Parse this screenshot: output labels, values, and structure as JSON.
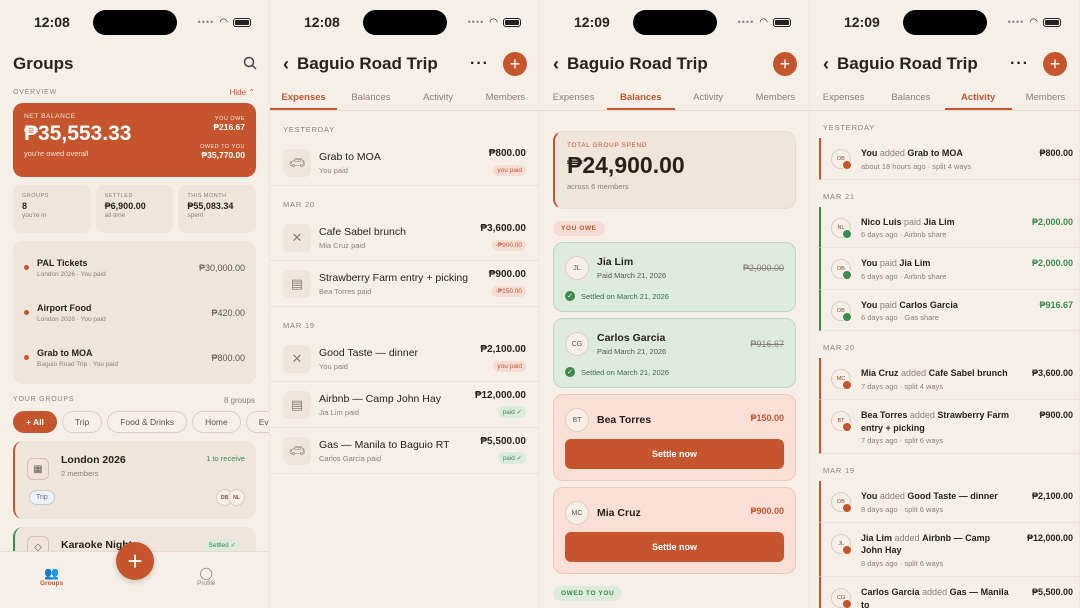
{
  "screen1": {
    "time": "12:08",
    "title": "Groups",
    "overview_label": "OVERVIEW",
    "hide_label": "Hide",
    "net_label": "NET BALANCE",
    "net_value": "₱35,553.33",
    "net_sub": "you're owed overall",
    "you_owe_label": "YOU OWE",
    "you_owe_value": "₱216.67",
    "owed_label": "OWED TO YOU",
    "owed_value": "₱35,770.00",
    "stats": [
      {
        "label": "GROUPS",
        "value": "8",
        "sub": "you're in"
      },
      {
        "label": "SETTLED",
        "value": "₱6,900.00",
        "sub": "all time"
      },
      {
        "label": "THIS MONTH",
        "value": "₱55,083.34",
        "sub": "spent"
      }
    ],
    "recent": [
      {
        "title": "PAL Tickets",
        "sub": "London 2026 · You paid",
        "amount": "₱30,000.00"
      },
      {
        "title": "Airport Food",
        "sub": "London 2026 · You paid",
        "amount": "₱420.00"
      },
      {
        "title": "Grab to MOA",
        "sub": "Baguio Road Trip · You paid",
        "amount": "₱800.00"
      }
    ],
    "your_groups_label": "YOUR GROUPS",
    "groups_count": "8 groups",
    "chips": [
      "+ All",
      "Trip",
      "Food & Drinks",
      "Home",
      "Eve"
    ],
    "group1": {
      "name": "London 2026",
      "members": "2 members",
      "status": "1 to receive",
      "tag": "Trip",
      "avatars": [
        "DB",
        "NL"
      ]
    },
    "group2": {
      "name": "Karaoke Night",
      "status": "Settled ✓"
    },
    "nav": {
      "groups": "Groups",
      "profile": "Profile"
    }
  },
  "screen2": {
    "time": "12:08",
    "title": "Baguio Road Trip",
    "tabs": [
      "Expenses",
      "Balances",
      "Activity",
      "Members"
    ],
    "sections": [
      {
        "label": "YESTERDAY",
        "items": [
          {
            "title": "Grab to MOA",
            "sub": "You paid",
            "amount": "₱800.00",
            "pill": "you paid",
            "pill_type": "red",
            "icon": "car"
          }
        ]
      },
      {
        "label": "MAR 20",
        "items": [
          {
            "title": "Cafe Sabel brunch",
            "sub": "Mia Cruz paid",
            "amount": "₱3,600.00",
            "pill": "-₱900.00",
            "pill_type": "red",
            "icon": "food"
          },
          {
            "title": "Strawberry Farm entry + picking",
            "sub": "Bea Torres paid",
            "amount": "₱900.00",
            "pill": "-₱150.00",
            "pill_type": "red",
            "icon": "receipt"
          }
        ]
      },
      {
        "label": "MAR 19",
        "items": [
          {
            "title": "Good Taste — dinner",
            "sub": "You paid",
            "amount": "₱2,100.00",
            "pill": "you paid",
            "pill_type": "red",
            "icon": "food"
          },
          {
            "title": "Airbnb — Camp John Hay",
            "sub": "Jia Lim paid",
            "amount": "₱12,000.00",
            "pill": "paid ✓",
            "pill_type": "green",
            "icon": "receipt"
          },
          {
            "title": "Gas — Manila to Baguio RT",
            "sub": "Carlos Garcia paid",
            "amount": "₱5,500.00",
            "pill": "paid ✓",
            "pill_type": "green",
            "icon": "car"
          }
        ]
      }
    ]
  },
  "screen3": {
    "time": "12:09",
    "title": "Baguio Road Trip",
    "tabs": [
      "Expenses",
      "Balances",
      "Activity",
      "Members"
    ],
    "total_label": "TOTAL GROUP SPEND",
    "total_value": "₱24,900.00",
    "total_sub": "across 6 members",
    "you_owe_label": "YOU OWE",
    "owed_to_you_label": "OWED TO YOU",
    "settled_cards": [
      {
        "initials": "JL",
        "name": "Jia Lim",
        "paid": "Paid March 21, 2026",
        "amount": "₱2,000.00",
        "settled": "Settled on March 21, 2026"
      },
      {
        "initials": "CG",
        "name": "Carlos Garcia",
        "paid": "Paid March 21, 2026",
        "amount": "₱916.67",
        "settled": "Settled on March 21, 2026"
      }
    ],
    "owe_cards": [
      {
        "initials": "BT",
        "name": "Bea Torres",
        "amount": "₱150.00",
        "button": "Settle now"
      },
      {
        "initials": "MC",
        "name": "Mia Cruz",
        "amount": "₱900.00",
        "button": "Settle now"
      }
    ]
  },
  "screen4": {
    "time": "12:09",
    "title": "Baguio Road Trip",
    "tabs": [
      "Expenses",
      "Balances",
      "Activity",
      "Members"
    ],
    "sections": [
      {
        "label": "YESTERDAY",
        "items": [
          {
            "initials": "DB",
            "actor": "You",
            "verb": "added",
            "object": "Grab to MOA",
            "sub": "about 18 hours ago · split 4 ways",
            "amount": "₱800.00",
            "type": "expense"
          }
        ]
      },
      {
        "label": "MAR 21",
        "items": [
          {
            "initials": "NL",
            "actor": "Nico Luis",
            "verb": "paid",
            "object": "Jia Lim",
            "sub": "6 days ago · Airbnb share",
            "amount": "₱2,000.00",
            "type": "payment"
          },
          {
            "initials": "DB",
            "actor": "You",
            "verb": "paid",
            "object": "Jia Lim",
            "sub": "6 days ago · Airbnb share",
            "amount": "₱2,000.00",
            "type": "payment"
          },
          {
            "initials": "DB",
            "actor": "You",
            "verb": "paid",
            "object": "Carlos Garcia",
            "sub": "6 days ago · Gas share",
            "amount": "₱916.67",
            "type": "payment"
          }
        ]
      },
      {
        "label": "MAR 20",
        "items": [
          {
            "initials": "MC",
            "actor": "Mia Cruz",
            "verb": "added",
            "object": "Cafe Sabel brunch",
            "sub": "7 days ago · split 4 ways",
            "amount": "₱3,600.00",
            "type": "expense"
          },
          {
            "initials": "BT",
            "actor": "Bea Torres",
            "verb": "added",
            "object": "Strawberry Farm entry + picking",
            "sub": "7 days ago · split 6 ways",
            "amount": "₱900.00",
            "type": "expense"
          }
        ]
      },
      {
        "label": "MAR 19",
        "items": [
          {
            "initials": "DB",
            "actor": "You",
            "verb": "added",
            "object": "Good Taste — dinner",
            "sub": "8 days ago · split 6 ways",
            "amount": "₱2,100.00",
            "type": "expense"
          },
          {
            "initials": "JL",
            "actor": "Jia Lim",
            "verb": "added",
            "object": "Airbnb — Camp John Hay",
            "sub": "8 days ago · split 6 ways",
            "amount": "₱12,000.00",
            "type": "expense"
          },
          {
            "initials": "CG",
            "actor": "Carlos Garcia",
            "verb": "added",
            "object": "Gas — Manila to",
            "sub": "",
            "amount": "₱5,500.00",
            "type": "expense"
          }
        ]
      }
    ]
  }
}
